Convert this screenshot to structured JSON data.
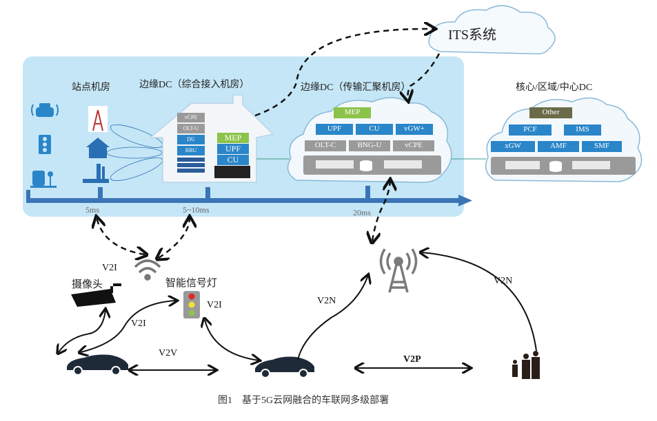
{
  "its": {
    "label": "ITS系统"
  },
  "site_room": {
    "label": "站点机房"
  },
  "edge_dc_access": {
    "label": "边缘DC（综合接入机房）",
    "stack_left": [
      "vCPE",
      "OLT-U",
      "DU",
      "BBU"
    ],
    "stack_right": [
      "MEP",
      "UPF",
      "CU"
    ]
  },
  "edge_dc_transport": {
    "label": "边缘DC（传输汇聚机房）",
    "row1": [
      "MEP"
    ],
    "row2": [
      "UPF",
      "CU",
      "vGW+"
    ],
    "row3": [
      "OLT-C",
      "BNG-U",
      "vCPE"
    ]
  },
  "core_dc": {
    "label": "核心/区域/中心DC",
    "row1": [
      "Other"
    ],
    "row2": [
      "PCF",
      "IMS"
    ],
    "row3": [
      "xGW",
      "AMF",
      "SMF"
    ]
  },
  "latency": {
    "site": "5ms",
    "edge_access": "5~10ms",
    "edge_transport": "20ms"
  },
  "devices": {
    "camera": "摄像头",
    "traffic_light": "智能信号灯"
  },
  "links": {
    "v2i_camera": "V2I",
    "v2i_light": "V2I",
    "v2i_car": "V2I",
    "v2v": "V2V",
    "v2n_car": "V2N",
    "v2n_people": "V2N",
    "v2p": "V2P"
  },
  "caption": "图1　基于5G云网融合的车联网多级部署",
  "colors": {
    "panel": "#c5e6f7",
    "blue": "#2a86c9",
    "gray": "#9a9a9a",
    "green": "#8cc34a",
    "axis": "#3b75b5",
    "dark": "#1f2a38"
  }
}
